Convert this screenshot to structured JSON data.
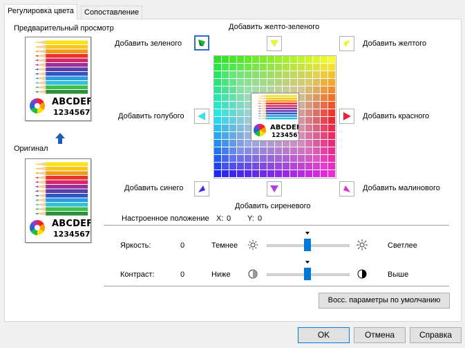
{
  "tabs": [
    {
      "label": "Регулировка цвета"
    },
    {
      "label": "Сопоставление"
    }
  ],
  "preview": {
    "title": "Предварительный просмотр",
    "text1": "ABCDEF",
    "text2": "1234567"
  },
  "original": {
    "title": "Оригинал"
  },
  "adjust": {
    "green": "Добавить зеленого",
    "yellow_green": "Добавить желто-зеленого",
    "yellow": "Добавить желтого",
    "cyan": "Добавить голубого",
    "red": "Добавить красного",
    "blue": "Добавить синего",
    "violet": "Добавить сиреневого",
    "magenta": "Добавить малинового"
  },
  "position": {
    "label": "Настроенное положение",
    "x_label": "X:",
    "x": "0",
    "y_label": "Y:",
    "y": "0"
  },
  "brightness": {
    "label": "Яркость:",
    "value": "0",
    "low": "Темнее",
    "high": "Светлее",
    "level": 0.5
  },
  "contrast": {
    "label": "Контраст:",
    "value": "0",
    "low": "Ниже",
    "high": "Выше",
    "level": 0.5
  },
  "reset_button": "Восс. параметры по умолчанию",
  "footer": {
    "ok": "OK",
    "cancel": "Отмена",
    "help": "Справка"
  },
  "colors": {
    "accent": "#0078d7",
    "selected_border": "#2a6cd1"
  }
}
